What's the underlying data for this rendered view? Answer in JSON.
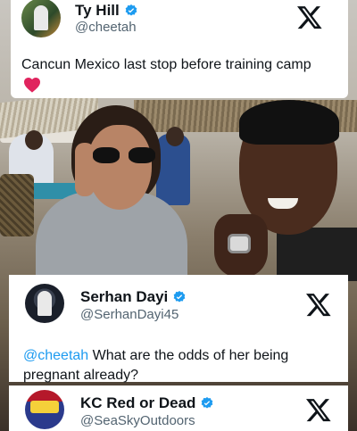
{
  "tweets": [
    {
      "name": "Ty Hill",
      "handle": "@cheetah",
      "text": "Cancun Mexico last stop before training camp",
      "emoji": "heart"
    },
    {
      "name": "Serhan Dayi",
      "handle": "@SerhanDayi45",
      "mention": "@cheetah",
      "text": " What are the odds of her being pregnant already?"
    },
    {
      "name": "KC Red or Dead",
      "handle": "@SeaSkyOutdoors"
    }
  ],
  "icons": {
    "verified": "verified-badge-icon",
    "platform": "x-logo-icon",
    "heart": "red-heart-icon"
  },
  "colors": {
    "verified_blue": "#1d9bf0",
    "mention_blue": "#1d9bf0",
    "heart_red": "#e0245e"
  }
}
